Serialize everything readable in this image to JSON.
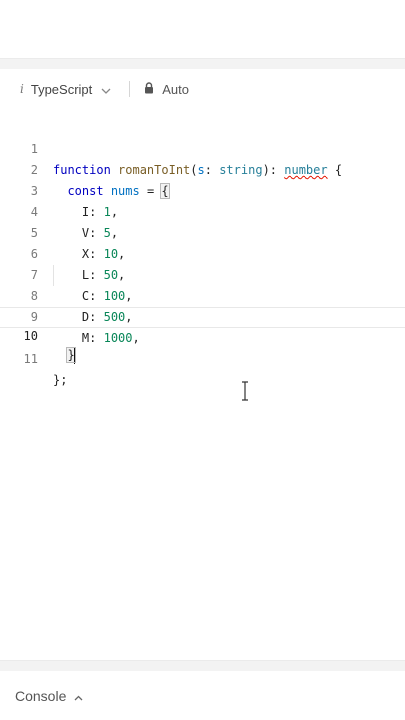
{
  "toolbar": {
    "language_icon": "i",
    "language_label": "TypeScript",
    "mode_label": "Auto"
  },
  "editor": {
    "active_line": 10,
    "lines": [
      {
        "n": "1"
      },
      {
        "n": "2"
      },
      {
        "n": "3"
      },
      {
        "n": "4"
      },
      {
        "n": "5"
      },
      {
        "n": "6"
      },
      {
        "n": "7"
      },
      {
        "n": "8"
      },
      {
        "n": "9"
      },
      {
        "n": "10"
      },
      {
        "n": "11"
      }
    ],
    "tokens": {
      "function_kw": "function",
      "fn_name": "romanToInt",
      "param_open": "(",
      "param_name": "s",
      "colon_space": ": ",
      "param_type": "string",
      "ret_sep": "): ",
      "ret_type": "number",
      "brace_open": " {",
      "const_kw": "const",
      "var_name": "nums",
      "assign": " = ",
      "obj_open": "{",
      "entries": [
        {
          "key": "I: ",
          "val": "1",
          "end": ","
        },
        {
          "key": "V: ",
          "val": "5",
          "end": ","
        },
        {
          "key": "X: ",
          "val": "10",
          "end": ","
        },
        {
          "key": "L: ",
          "val": "50",
          "end": ","
        },
        {
          "key": "C: ",
          "val": "100",
          "end": ","
        },
        {
          "key": "D: ",
          "val": "500",
          "end": ","
        },
        {
          "key": "M: ",
          "val": "1000",
          "end": ","
        }
      ],
      "obj_close": "}",
      "fn_close": "};"
    }
  },
  "console": {
    "label": "Console"
  },
  "colors": {
    "keyword": "#0000c0",
    "function_name": "#795e26",
    "variable": "#0070c1",
    "number": "#098658",
    "type": "#267f99",
    "error_squiggle": "#e51400"
  }
}
